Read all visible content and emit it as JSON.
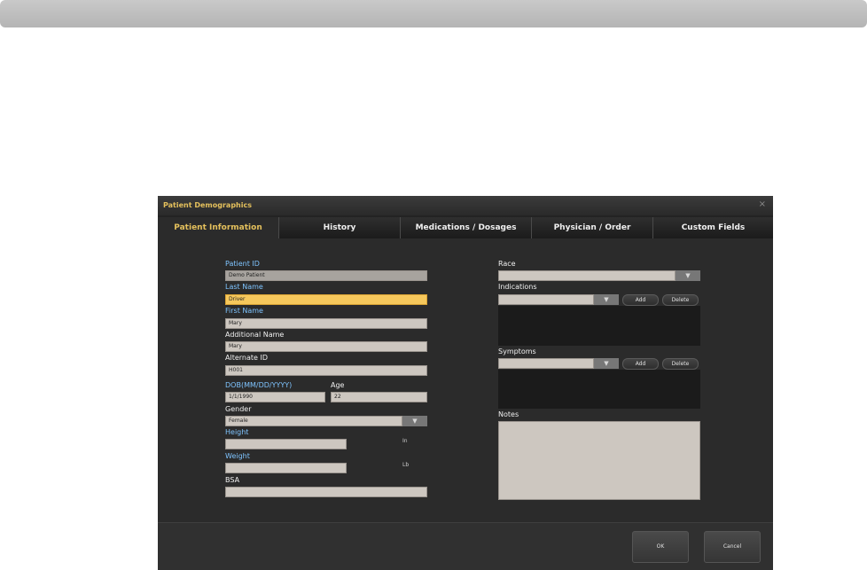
{
  "dialog": {
    "title": "Patient Demographics",
    "close_icon": "×"
  },
  "tabs": [
    "Patient Information",
    "History",
    "Medications / Dosages",
    "Physician / Order",
    "Custom Fields"
  ],
  "form": {
    "patient_id": {
      "label": "Patient ID",
      "value": "Demo Patient"
    },
    "last_name": {
      "label": "Last Name",
      "value": "Driver"
    },
    "first_name": {
      "label": "First Name",
      "value": "Mary"
    },
    "additional_name": {
      "label": "Additional Name",
      "value": "Mary"
    },
    "alternate_id": {
      "label": "Alternate ID",
      "value": "H001"
    },
    "dob": {
      "label": "DOB(MM/DD/YYYY)",
      "value": "1/1/1990"
    },
    "age": {
      "label": "Age",
      "value": "22"
    },
    "gender": {
      "label": "Gender",
      "value": "Female"
    },
    "height": {
      "label": "Height",
      "value": "",
      "unit": "In"
    },
    "weight": {
      "label": "Weight",
      "value": "",
      "unit": "Lb"
    },
    "bsa": {
      "label": "BSA",
      "value": ""
    },
    "race": {
      "label": "Race",
      "value": ""
    },
    "indications": {
      "label": "Indications",
      "value": "",
      "add": "Add",
      "delete": "Delete"
    },
    "symptoms": {
      "label": "Symptoms",
      "value": "",
      "add": "Add",
      "delete": "Delete"
    },
    "notes": {
      "label": "Notes"
    },
    "dropdown_glyph": "▼"
  },
  "footer": {
    "ok": "OK",
    "cancel": "Cancel"
  },
  "colors": {
    "accent_title": "#e4c05c",
    "label_blue": "#7fc4ff",
    "focus_field": "#f6c85c"
  }
}
